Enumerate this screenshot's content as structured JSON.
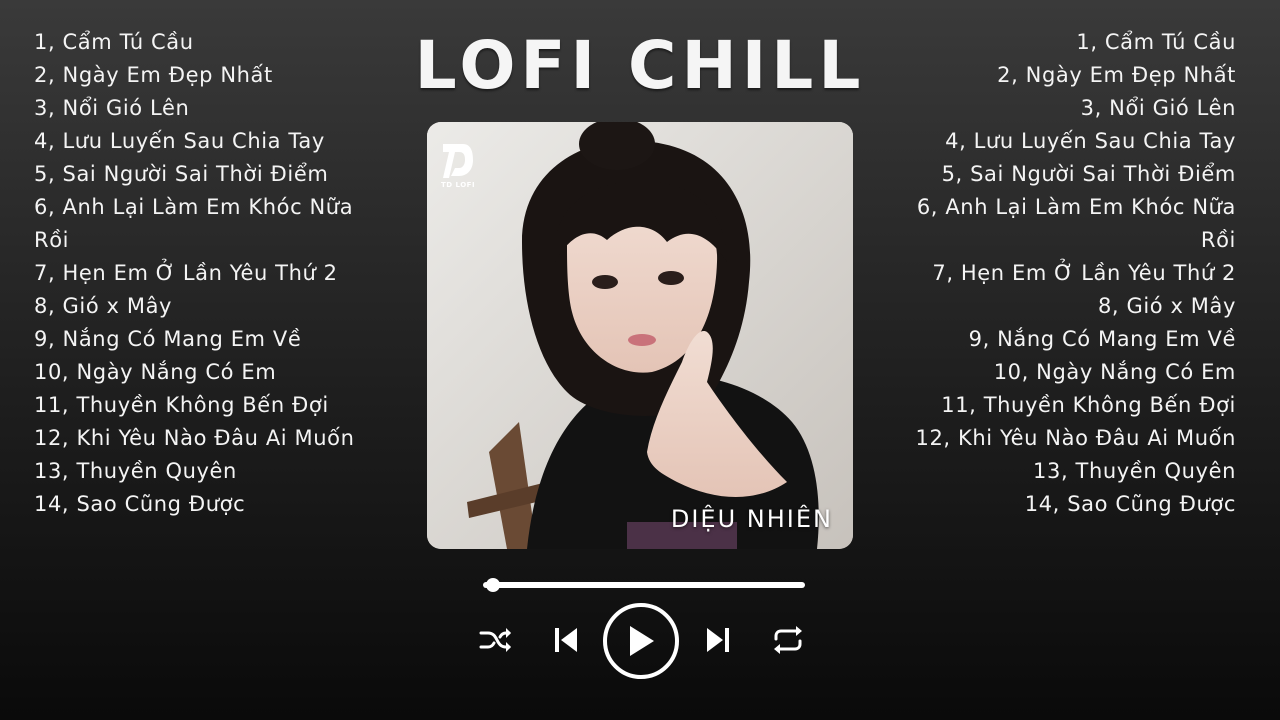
{
  "title": "LOFI CHILL",
  "artist": "DIỆU NHIÊN",
  "logo_text": "TD LOFI",
  "tracks": [
    "1, Cẩm Tú Cầu",
    "2, Ngày Em Đẹp Nhất",
    "3, Nổi Gió Lên",
    "4, Lưu Luyến Sau Chia Tay",
    "5, Sai Người Sai Thời Điểm",
    "6, Anh Lại Làm Em Khóc Nữa Rồi",
    "7, Hẹn Em Ở Lần Yêu Thứ 2",
    "8, Gió x Mây",
    "9, Nắng Có Mang Em Về",
    "10, Ngày Nắng Có Em",
    "11, Thuyền Không Bến Đợi",
    "12, Khi Yêu Nào Đâu Ai Muốn",
    "13, Thuyền Quyên",
    "14, Sao Cũng Được"
  ],
  "player": {
    "progress": 0.03,
    "controls": {
      "shuffle": "shuffle-icon",
      "previous": "skip-previous-icon",
      "play": "play-icon",
      "next": "skip-next-icon",
      "repeat": "repeat-icon"
    }
  },
  "colors": {
    "background_top": "#3a3a3a",
    "background_bottom": "#0a0a0a",
    "text": "#f4f4f4",
    "controls": "#ffffff"
  }
}
